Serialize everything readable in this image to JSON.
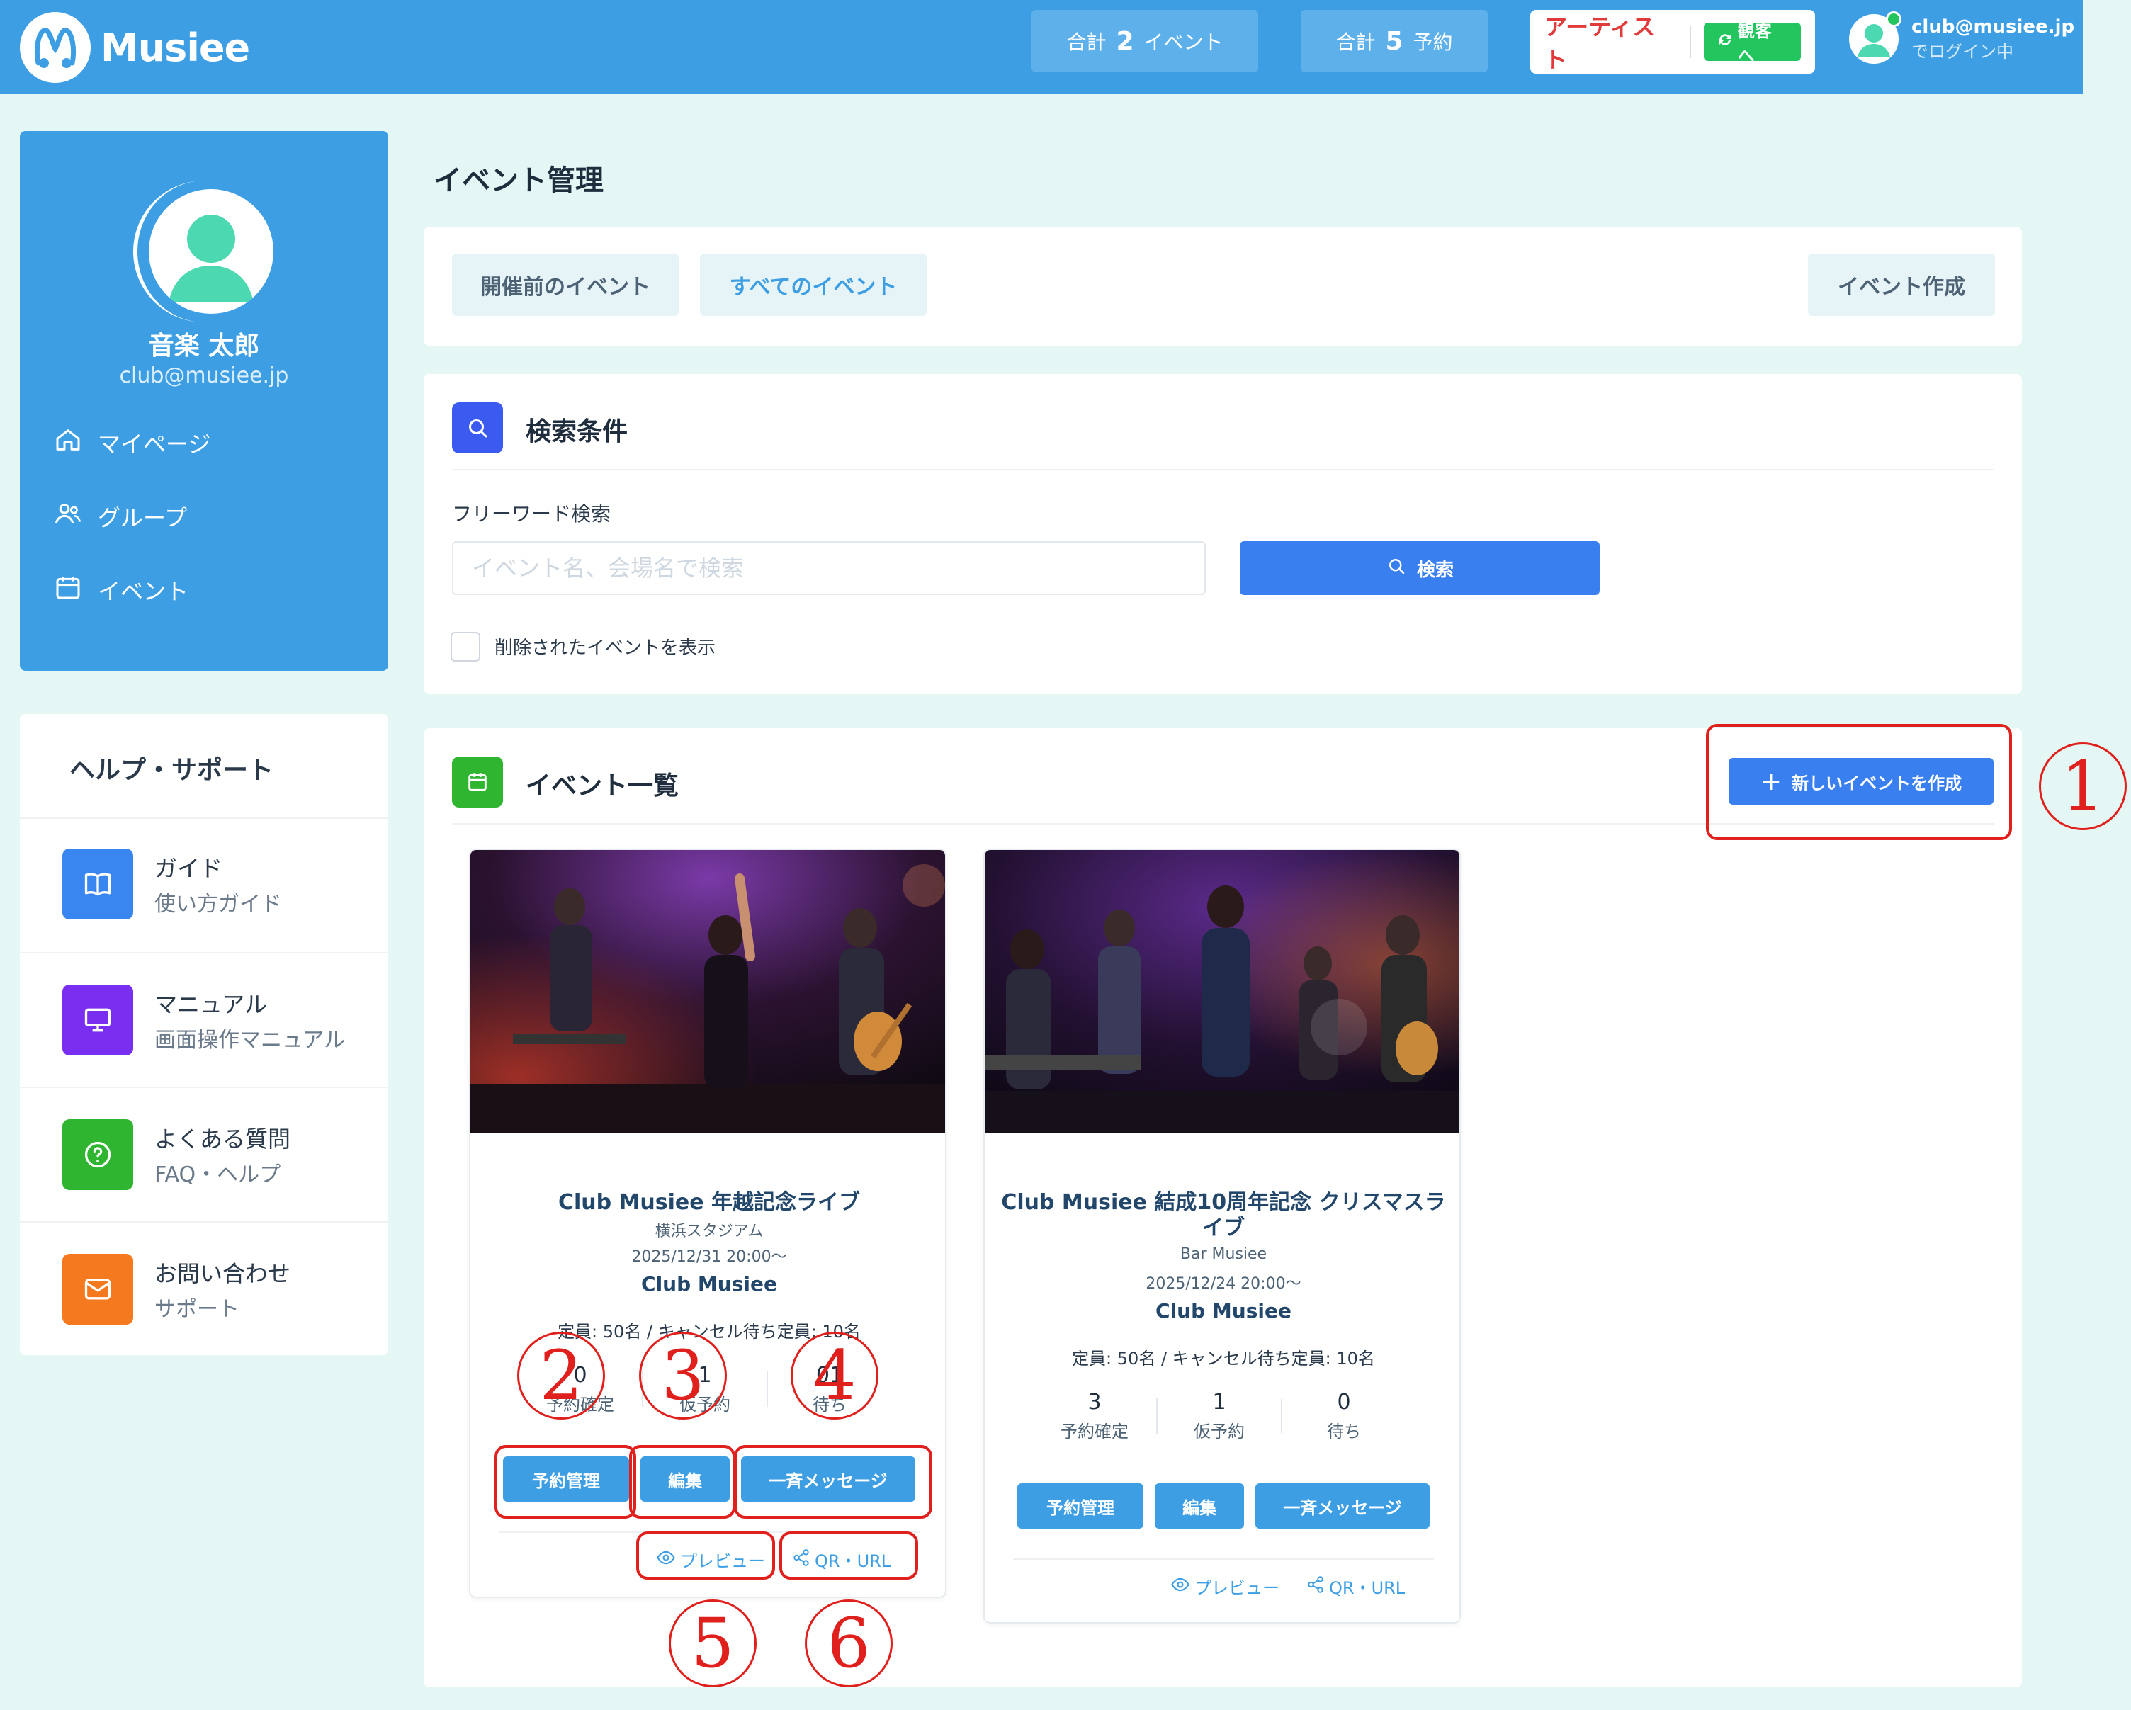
{
  "header": {
    "brand": "Musiee",
    "stats": [
      {
        "prefix": "合計",
        "value": "2",
        "unit": "イベント"
      },
      {
        "prefix": "合計",
        "value": "5",
        "unit": "予約"
      }
    ],
    "mode_label": "アーティスト",
    "mode_switch": "観客へ",
    "user_email": "club@musiee.jp",
    "user_status": "でログイン中"
  },
  "sidebar": {
    "name": "音楽 太郎",
    "email": "club@musiee.jp",
    "nav": [
      {
        "label": "マイページ",
        "icon": "home-icon"
      },
      {
        "label": "グループ",
        "icon": "users-icon"
      },
      {
        "label": "イベント",
        "icon": "calendar-icon"
      }
    ],
    "help_title": "ヘルプ・サポート",
    "help_items": [
      {
        "title": "ガイド",
        "subtitle": "使い方ガイド",
        "icon": "book-icon",
        "color": "#3a86f0"
      },
      {
        "title": "マニュアル",
        "subtitle": "画面操作マニュアル",
        "icon": "monitor-icon",
        "color": "#7a2ff0"
      },
      {
        "title": "よくある質問",
        "subtitle": "FAQ・ヘルプ",
        "icon": "question-icon",
        "color": "#2fb52f"
      },
      {
        "title": "お問い合わせ",
        "subtitle": "サポート",
        "icon": "mail-icon",
        "color": "#f57a1f"
      }
    ]
  },
  "main": {
    "page_title": "イベント管理",
    "tabs": [
      "開催前のイベント",
      "すべてのイベント"
    ],
    "create_tab": "イベント作成",
    "search": {
      "title": "検索条件",
      "label": "フリーワード検索",
      "placeholder": "イベント名、会場名で検索",
      "button": "検索",
      "checkbox_label": "削除されたイベントを表示"
    },
    "events_title": "イベント一覧",
    "new_event_button": "新しいイベントを作成",
    "events": [
      {
        "title": "Club Musiee 年越記念ライブ",
        "venue": "横浜スタジアム",
        "date": "2025/12/31 20:00〜",
        "organizer": "Club Musiee",
        "capacity": "定員: 50名 / キャンセル待ち定員: 10名",
        "stats": [
          {
            "value": "0",
            "label": "予約確定"
          },
          {
            "value": "1",
            "label": "仮予約"
          },
          {
            "value": "01",
            "label": "待ち"
          }
        ],
        "buttons": [
          "予約管理",
          "編集",
          "一斉メッセージ"
        ],
        "links": [
          "プレビュー",
          "QR・URL"
        ]
      },
      {
        "title": "Club Musiee 結成10周年記念 クリスマスライブ",
        "venue": "Bar Musiee",
        "date": "2025/12/24 20:00〜",
        "organizer": "Club Musiee",
        "capacity": "定員: 50名 / キャンセル待ち定員: 10名",
        "stats": [
          {
            "value": "3",
            "label": "予約確定"
          },
          {
            "value": "1",
            "label": "仮予約"
          },
          {
            "value": "0",
            "label": "待ち"
          }
        ],
        "buttons": [
          "予約管理",
          "編集",
          "一斉メッセージ"
        ],
        "links": [
          "プレビュー",
          "QR・URL"
        ]
      }
    ]
  },
  "annotations": [
    "1",
    "2",
    "3",
    "4",
    "5",
    "6"
  ],
  "colors": {
    "primary": "#3d9ee3",
    "action": "#3a7ff0",
    "background": "#e4f7f5",
    "annotation": "#e0201c"
  }
}
